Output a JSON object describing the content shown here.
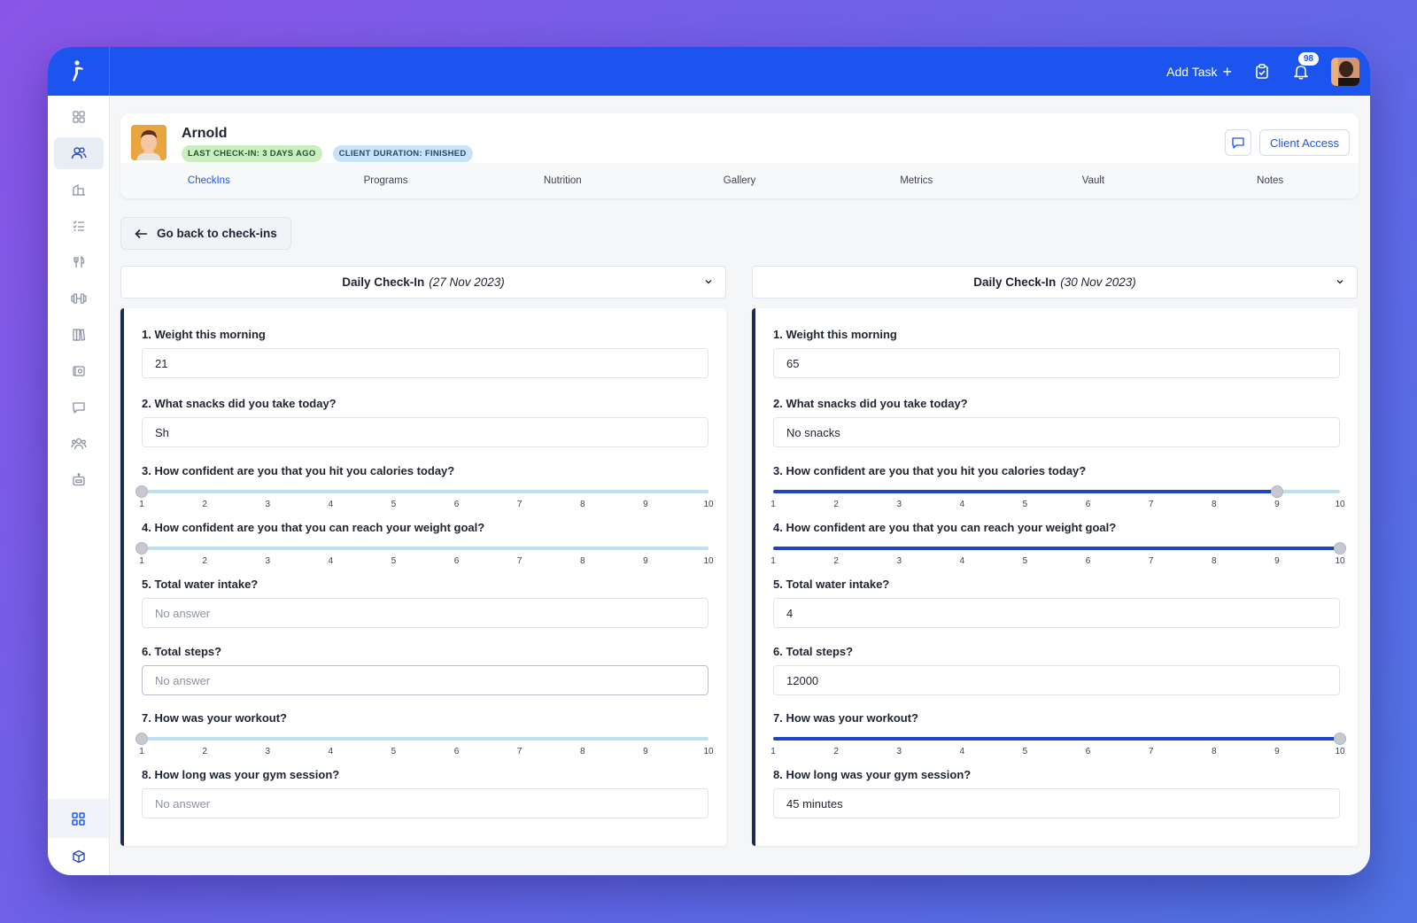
{
  "topbar": {
    "add_task_label": "Add Task",
    "notification_count": "98"
  },
  "client": {
    "name": "Arnold",
    "badge_last_checkin": "LAST CHECK-IN: 3 DAYS AGO",
    "badge_duration": "CLIENT DURATION: FINISHED",
    "client_access_label": "Client Access"
  },
  "tabs": [
    "CheckIns",
    "Programs",
    "Nutrition",
    "Gallery",
    "Metrics",
    "Vault",
    "Notes"
  ],
  "active_tab": "CheckIns",
  "back_label": "Go back to check-ins",
  "questions": [
    "1. Weight this morning",
    "2. What snacks did you take today?",
    "3. How confident are you that you hit you calories today?",
    "4. How confident are you that you can reach your weight goal?",
    "5. Total water intake?",
    "6. Total steps?",
    "7. How was your workout?",
    "8. How long was your gym session?"
  ],
  "scale_ticks": [
    "1",
    "2",
    "3",
    "4",
    "5",
    "6",
    "7",
    "8",
    "9",
    "10"
  ],
  "checkins": [
    {
      "title": "Daily Check-In",
      "date": "(27 Nov 2023)",
      "answers": {
        "weight": "21",
        "snacks": "Sh",
        "calories_confidence": 1,
        "goal_confidence": 1,
        "water": "No answer",
        "steps": "No answer",
        "workout": 1,
        "gym_session": "No answer"
      }
    },
    {
      "title": "Daily Check-In",
      "date": "(30 Nov 2023)",
      "answers": {
        "weight": "65",
        "snacks": "No snacks",
        "calories_confidence": 9,
        "goal_confidence": 10,
        "water": "4",
        "steps": "12000",
        "workout": 10,
        "gym_session": "45 minutes"
      }
    }
  ],
  "colors": {
    "brand": "#1c54f0",
    "slider_fill": "#1f45c7",
    "slider_track": "#bfe0f2"
  }
}
